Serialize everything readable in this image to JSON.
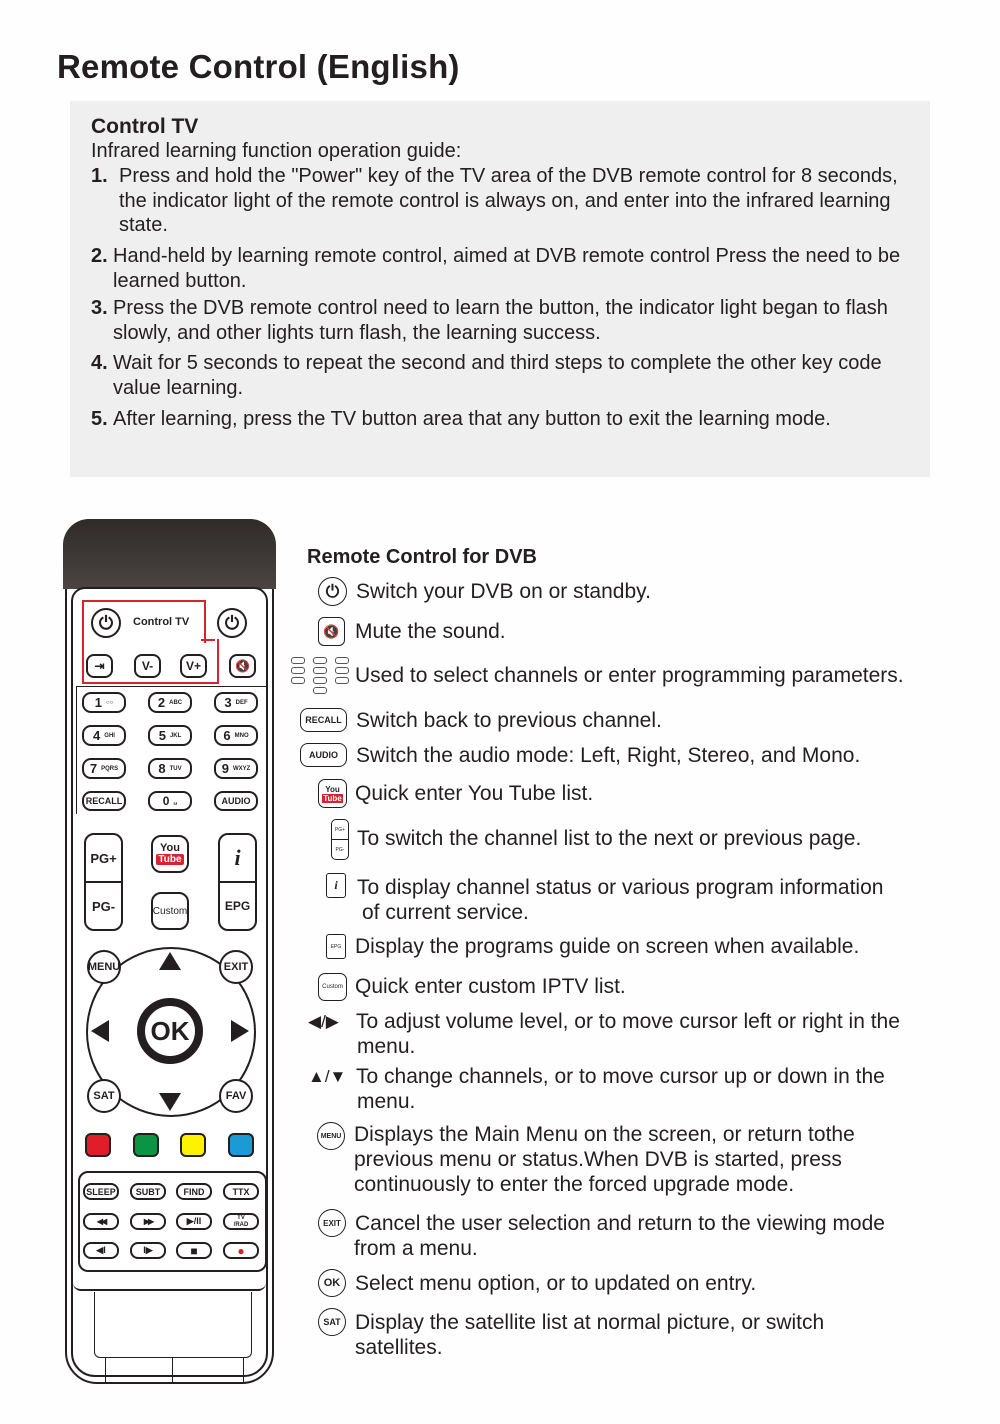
{
  "page": {
    "title": "Remote Control (English)"
  },
  "guide": {
    "heading": "Control TV",
    "subheading": "Infrared learning function operation guide:",
    "steps": [
      {
        "num": "1.",
        "text": "Press and hold the \"Power\" key of the TV area of the DVB remote control for 8 seconds, the indicator light of the remote control is always on, and enter into the infrared learning state."
      },
      {
        "num": "2.",
        "text": "Hand-held by learning remote control, aimed at DVB remote control Press the need to be learned button."
      },
      {
        "num": "3.",
        "text": "Press the DVB remote control need to learn the button, the indicator light began to flash slowly, and other lights turn flash, the learning success."
      },
      {
        "num": "4.",
        "text": "Wait for 5 seconds to repeat the second and third steps to complete the other key code value learning."
      },
      {
        "num": "5.",
        "text": "After learning, press the TV button area that any button to exit the learning mode."
      }
    ]
  },
  "remote": {
    "control_tv_label": "Control TV",
    "vol_minus": "V-",
    "vol_plus": "V+",
    "digits": [
      {
        "n": "1",
        "s": "○○"
      },
      {
        "n": "2",
        "s": "ABC"
      },
      {
        "n": "3",
        "s": "DEF"
      },
      {
        "n": "4",
        "s": "GHI"
      },
      {
        "n": "5",
        "s": "JKL"
      },
      {
        "n": "6",
        "s": "MNO"
      },
      {
        "n": "7",
        "s": "PQRS"
      },
      {
        "n": "8",
        "s": "TUV"
      },
      {
        "n": "9",
        "s": "WXYZ"
      },
      {
        "n": "0",
        "s": "␣"
      }
    ],
    "recall": "RECALL",
    "audio": "AUDIO",
    "pg_plus": "PG+",
    "pg_minus": "PG-",
    "youtube_you": "You",
    "youtube_tube": "Tube",
    "info": "i",
    "epg": "EPG",
    "custom": "Custom",
    "menu": "MENU",
    "exit": "EXIT",
    "ok": "OK",
    "sat": "SAT",
    "fav": "FAV",
    "colors": [
      "#e11d2a",
      "#0b9444",
      "#fff200",
      "#1c9ad6"
    ],
    "func_row1": [
      "SLEEP",
      "SUBT",
      "FIND",
      "TTX"
    ],
    "rewind": "◀◀",
    "fastforward": "▶▶",
    "playpause": "▶/II",
    "tvrad_top": "TV",
    "tvrad_bottom": "/RAD",
    "prev": "◀I",
    "next": "I▶",
    "stop": "■",
    "record": "●",
    "record_color": "#e11d2a",
    "highlight_color": "#d7232e"
  },
  "dvb": {
    "title": "Remote Control for DVB",
    "items": [
      {
        "key": "power",
        "text": "Switch your DVB on or standby."
      },
      {
        "key": "mute",
        "text": "Mute the sound."
      },
      {
        "key": "digits",
        "text": "Used to select channels or enter programming parameters."
      },
      {
        "key": "RECALL",
        "text": "Switch back to previous channel."
      },
      {
        "key": "AUDIO",
        "text": "Switch the audio mode: Left, Right, Stereo, and Mono."
      },
      {
        "key": "youtube",
        "text": "Quick enter You Tube list."
      },
      {
        "key": "PG+/PG-",
        "text": "To switch the channel list to the next or previous page."
      },
      {
        "key": "i",
        "text": "To display channel status or various program information",
        "text2": "of current service."
      },
      {
        "key": "EPG",
        "text": "Display the programs guide on screen when available."
      },
      {
        "key": "Custom",
        "text": "Quick enter custom IPTV list."
      },
      {
        "key": "◀/▶",
        "text": "To adjust volume level, or to move cursor left or right in the",
        "text2": "menu."
      },
      {
        "key": "▲/▼",
        "text": "To change channels, or to move cursor up or down  in the",
        "text2": "menu."
      },
      {
        "key": "MENU",
        "text": "Displays the Main Menu on the screen, or return tothe",
        "text2": "previous menu or status.When DVB is started, press",
        "text3": "continuously to enter the forced upgrade mode."
      },
      {
        "key": "EXIT",
        "text": "Cancel the user selection and return to the viewing mode",
        "text2": "from  a menu."
      },
      {
        "key": "OK",
        "text": "Select menu option, or to updated on entry."
      },
      {
        "key": "SAT",
        "text": "Display the satellite list at normal picture, or switch",
        "text2": "satellites."
      }
    ]
  }
}
